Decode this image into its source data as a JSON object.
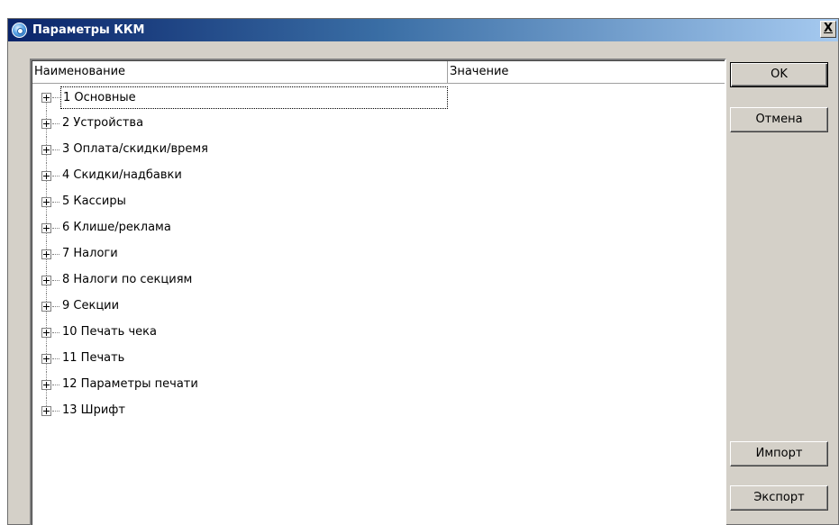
{
  "window": {
    "title": "Параметры ККМ",
    "icon": "settings-gear-icon",
    "close_label": "X"
  },
  "tree": {
    "columns": [
      "Наименование",
      "Значение"
    ],
    "nodes": [
      "1 Основные",
      "2 Устройства",
      "3 Оплата/скидки/время",
      "4 Скидки/надбавки",
      "5 Кассиры",
      "6 Клише/реклама",
      "7 Налоги",
      "8 Налоги по секциям",
      "9 Секции",
      "10 Печать чека",
      "11 Печать",
      "12 Параметры печати",
      "13 Шрифт"
    ]
  },
  "buttons": {
    "ok": "OK",
    "cancel": "Отмена",
    "import": "Импорт",
    "export": "Экспорт"
  }
}
